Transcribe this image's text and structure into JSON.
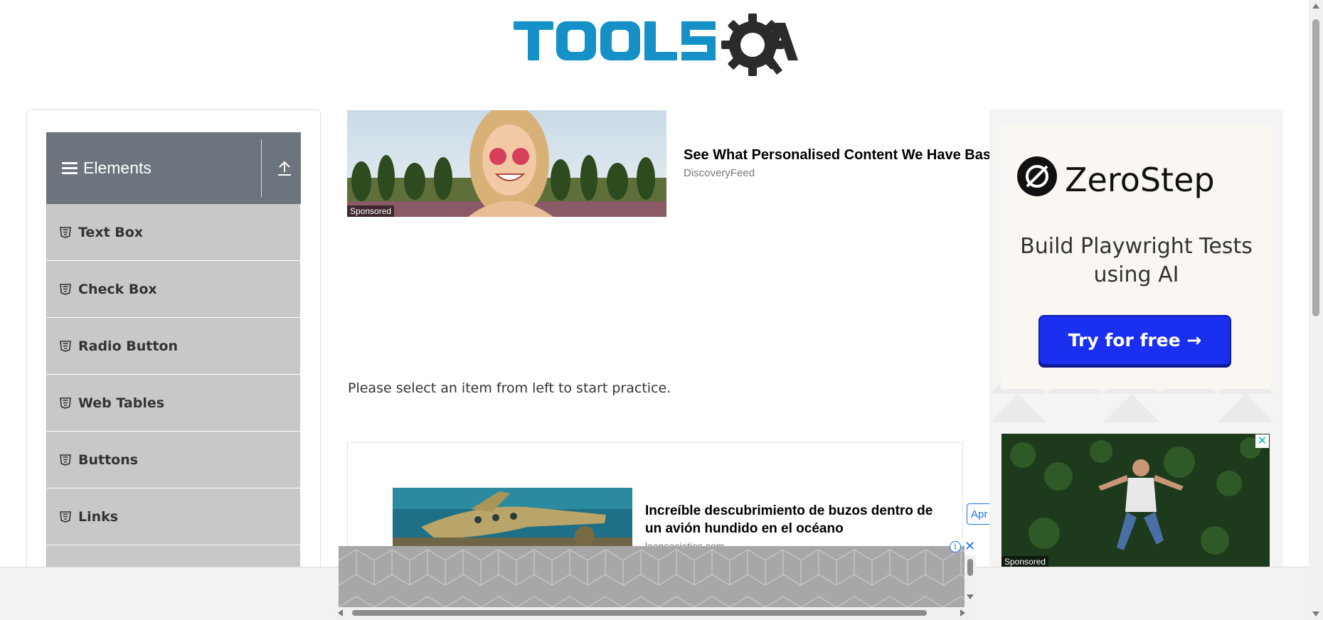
{
  "header": {
    "logo_text": "TOOLSQA"
  },
  "nav": {
    "group_title": "Elements",
    "items": [
      {
        "label": "Text Box"
      },
      {
        "label": "Check Box"
      },
      {
        "label": "Radio Button"
      },
      {
        "label": "Web Tables"
      },
      {
        "label": "Buttons"
      },
      {
        "label": "Links"
      }
    ]
  },
  "top_ad": {
    "sponsored": "Sponsored",
    "headline": "See What Personalised Content We Have Bas",
    "source": "DiscoveryFeed"
  },
  "main": {
    "instruction": "Please select an item from left to start practice."
  },
  "content_ad": {
    "headline": "Increíble descubrimiento de buzos dentro de un avión hundido en el océano",
    "source": "loansocieties.com",
    "cta": "Apr"
  },
  "right_ad": {
    "brand": "ZeroStep",
    "tagline": "Build Playwright Tests using AI",
    "button": "Try for free →",
    "sponsored": "Sponsored",
    "close": "✕"
  },
  "sticky_ad": {
    "info": "i",
    "close": "✕"
  },
  "colors": {
    "logo_blue": "#1591c8",
    "logo_dark": "#2b2b2b",
    "nav_header": "#6c757d",
    "nav_item": "#c8c8c8",
    "cta_blue": "#1a2ff0"
  },
  "icons": {
    "hamburger": "bars-icon",
    "collapse": "upload-arrow-icon",
    "item": "html5-icon"
  }
}
